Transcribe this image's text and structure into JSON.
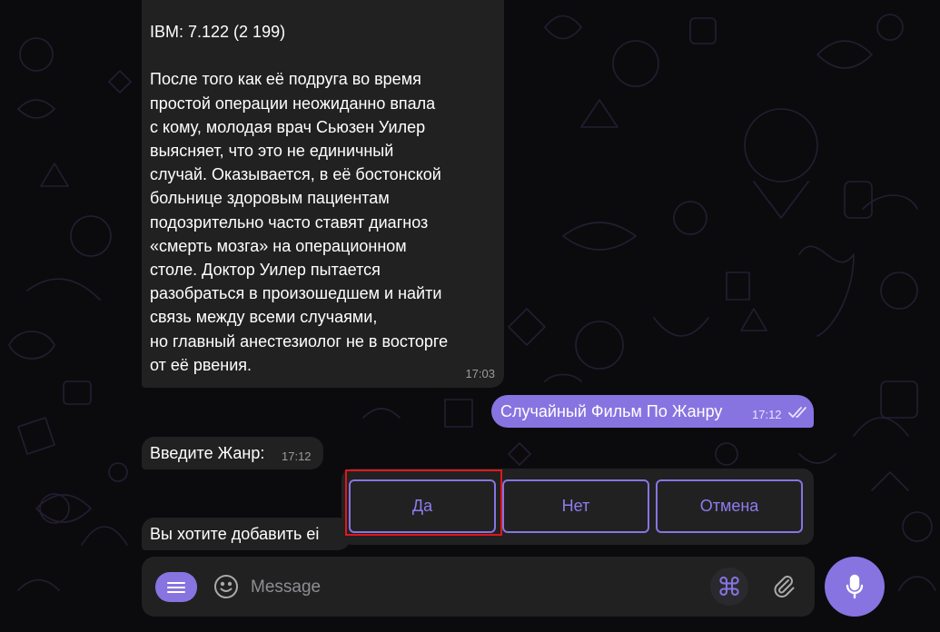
{
  "chat": {
    "messages": [
      {
        "id": "movie-info",
        "direction": "incoming",
        "text": "IBM: 7.122 (2 199)\n\nПосле того как её подруга во время\nпростой операции неожиданно впала\nс кому, молодая врач Сьюзен Уилер\nвыясняет, что это не единичный\nслучай. Оказывается, в её бостонской\nбольнице здоровым пациентам\nподозрительно часто ставят диагноз\n«смерть мозга» на операционном\nстоле. Доктор Уилер пытается\nразобраться в произошедшем и найти\nсвязь между всеми случаями,\nно главный анестезиолог не в восторге\nот её рвения.",
        "time": "17:03"
      },
      {
        "id": "random-film",
        "direction": "outgoing",
        "text": "Случайный Фильм По Жанру",
        "time": "17:12",
        "status": "read-double-check-icon"
      },
      {
        "id": "enter-genre",
        "direction": "incoming",
        "text": "Введите Жанр:",
        "time": "17:12"
      },
      {
        "id": "add-question",
        "direction": "incoming",
        "text": "Вы хотите добавить ei"
      }
    ]
  },
  "reply_keyboard": {
    "buttons": [
      {
        "label": "Да",
        "highlighted": true
      },
      {
        "label": "Нет"
      },
      {
        "label": "Отмена"
      }
    ]
  },
  "composer": {
    "placeholder": "Message",
    "menu_icon": "menu-lines-icon",
    "emoji_icon": "smiley-icon",
    "command_icon": "command-symbol-icon",
    "command_glyph": "⌘",
    "attach_icon": "paperclip-icon",
    "send_icon": "microphone-icon"
  },
  "colors": {
    "accent": "#8774e1",
    "bubble_in": "#212121",
    "background": "#0b0b0e",
    "highlight": "#e0161e"
  }
}
